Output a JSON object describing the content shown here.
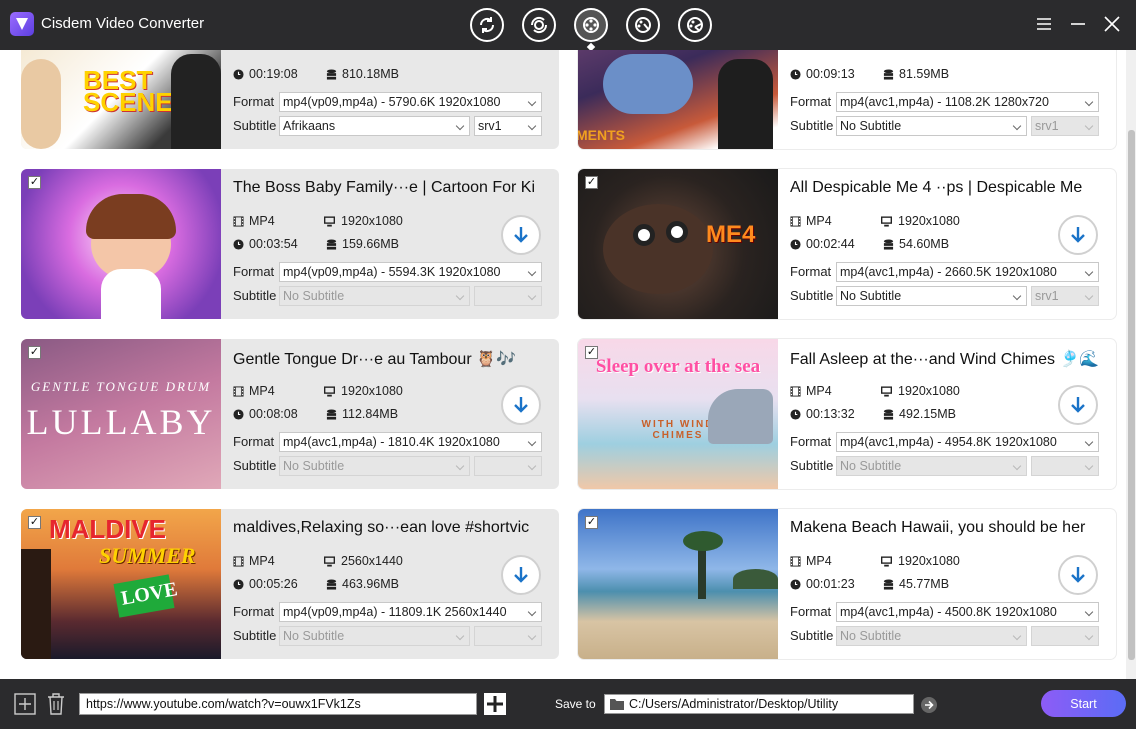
{
  "app": {
    "title": "Cisdem Video Converter"
  },
  "modes": [
    {
      "icon": "convert-icon"
    },
    {
      "icon": "rip-icon"
    },
    {
      "icon": "download-icon",
      "active": true
    },
    {
      "icon": "edit-icon"
    },
    {
      "icon": "compress-icon"
    }
  ],
  "labels": {
    "format": "Format",
    "subtitle": "Subtitle"
  },
  "cards": [
    {
      "title": "",
      "fmt": "",
      "res": "",
      "dur": "00:19:08",
      "size": "810.18MB",
      "format_value": "mp4(vp09,mp4a) - 5790.6K 1920x1080",
      "subtitle_value": "Afrikaans",
      "sub_track": "srv1",
      "subtitle_disabled": false,
      "track_disabled": false,
      "checked": false,
      "thumb_text": "BEST SCENES"
    },
    {
      "title": "",
      "fmt": "",
      "res": "",
      "dur": "00:09:13",
      "size": "81.59MB",
      "format_value": "mp4(avc1,mp4a) - 1108.2K 1280x720",
      "subtitle_value": "No Subtitle",
      "sub_track": "srv1",
      "subtitle_disabled": false,
      "track_disabled": true,
      "checked": false,
      "thumb_text": "MENTS"
    },
    {
      "title": "The Boss Baby Family···e | Cartoon For Ki",
      "fmt": "MP4",
      "res": "1920x1080",
      "dur": "00:03:54",
      "size": "159.66MB",
      "format_value": "mp4(vp09,mp4a) - 5594.3K 1920x1080",
      "subtitle_value": "No Subtitle",
      "sub_track": "",
      "subtitle_disabled": true,
      "track_disabled": true,
      "checked": true,
      "thumb_text": ""
    },
    {
      "title": "All Despicable Me 4 ··ps | Despicable Me",
      "fmt": "MP4",
      "res": "1920x1080",
      "dur": "00:02:44",
      "size": "54.60MB",
      "format_value": "mp4(avc1,mp4a) - 2660.5K 1920x1080",
      "subtitle_value": "No Subtitle",
      "sub_track": "srv1",
      "subtitle_disabled": false,
      "track_disabled": true,
      "checked": true,
      "thumb_text": "ME4"
    },
    {
      "title": "Gentle Tongue Dr···e au Tambour 🦉🎶",
      "fmt": "MP4",
      "res": "1920x1080",
      "dur": "00:08:08",
      "size": "112.84MB",
      "format_value": "mp4(avc1,mp4a) - 1810.4K 1920x1080",
      "subtitle_value": "No Subtitle",
      "sub_track": "",
      "subtitle_disabled": true,
      "track_disabled": true,
      "checked": true,
      "thumb_text": "GENTLE TONGUE DRUM",
      "thumb_text2": "LULLABY"
    },
    {
      "title": "Fall Asleep at the···and Wind Chimes 🎐🌊",
      "fmt": "MP4",
      "res": "1920x1080",
      "dur": "00:13:32",
      "size": "492.15MB",
      "format_value": "mp4(avc1,mp4a) - 4954.8K 1920x1080",
      "subtitle_value": "No Subtitle",
      "sub_track": "",
      "subtitle_disabled": true,
      "track_disabled": true,
      "checked": true,
      "thumb_text": "Sleep over at the sea",
      "thumb_text2": "WITH WIND CHIMES"
    },
    {
      "title": "maldives,Relaxing so···ean love #shortvic",
      "fmt": "MP4",
      "res": "2560x1440",
      "dur": "00:05:26",
      "size": "463.96MB",
      "format_value": "mp4(vp09,mp4a) - 11809.1K 2560x1440",
      "subtitle_value": "No Subtitle",
      "sub_track": "",
      "subtitle_disabled": true,
      "track_disabled": true,
      "checked": true,
      "thumb_text": "MALDIVE",
      "thumb_text2": "SUMMER",
      "thumb_text3": "LOVE"
    },
    {
      "title": "Makena Beach Hawaii, you should be her",
      "fmt": "MP4",
      "res": "1920x1080",
      "dur": "00:01:23",
      "size": "45.77MB",
      "format_value": "mp4(avc1,mp4a) - 4500.8K 1920x1080",
      "subtitle_value": "No Subtitle",
      "sub_track": "",
      "subtitle_disabled": true,
      "track_disabled": true,
      "checked": true,
      "thumb_text": ""
    }
  ],
  "bottom": {
    "url_value": "https://www.youtube.com/watch?v=ouwx1FVk1Zs",
    "save_label": "Save to",
    "save_path": "C:/Users/Administrator/Desktop/Utility",
    "start_label": "Start"
  },
  "colors": {
    "bar": "#2b2b2d",
    "accent": "#1a73c8",
    "start_from": "#8d5cf6",
    "start_to": "#5b6cf5"
  }
}
